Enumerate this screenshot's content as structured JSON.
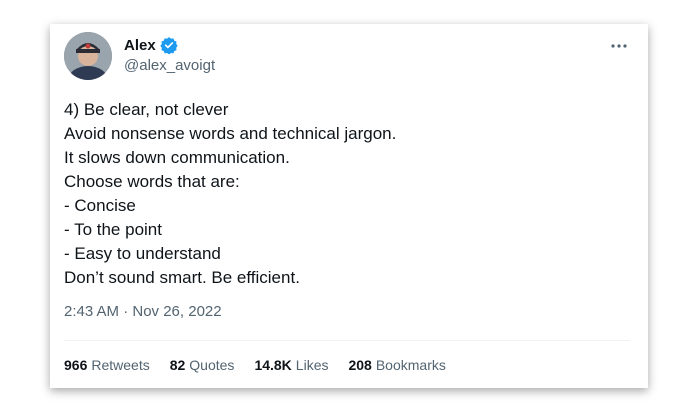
{
  "tweet": {
    "author_name": "Alex",
    "author_handle": "@alex_avoigt",
    "verified_color": "#1d9bf0",
    "lines": [
      "4) Be clear, not clever",
      "Avoid nonsense words and technical jargon.",
      "It slows down communication.",
      "Choose words that are:",
      "- Concise",
      "- To the point",
      "- Easy to understand",
      "Don’t sound smart. Be efficient."
    ],
    "timestamp": "2:43 AM · Nov 26, 2022",
    "stats": {
      "retweets_count": "966",
      "retweets_label": "Retweets",
      "quotes_count": "82",
      "quotes_label": "Quotes",
      "likes_count": "14.8K",
      "likes_label": "Likes",
      "bookmarks_count": "208",
      "bookmarks_label": "Bookmarks"
    }
  }
}
